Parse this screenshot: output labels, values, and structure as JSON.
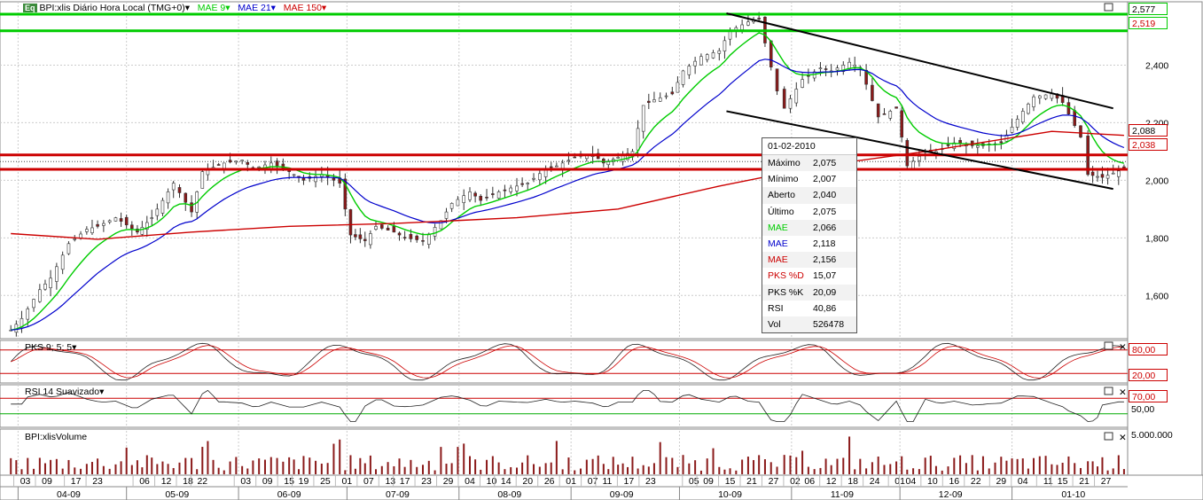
{
  "header": {
    "logo": "Eq",
    "symbol": "BPI:xlis Diário Hora Local (TMG+0)",
    "ma1": "MAE 9",
    "ma2": "MAE 21",
    "ma3": "MAE 150",
    "colors": {
      "ma1": "#00cc00",
      "ma2": "#0000cc",
      "ma3": "#cc0000"
    }
  },
  "chart_data": [
    {
      "type": "candlestick",
      "title": "BPI:xlis Diário Hora Local (TMG+0)",
      "ylim": [
        1.45,
        2.62
      ],
      "y_ticks": [
        "2,400",
        "2,200",
        "2,000",
        "1,800",
        "1,600"
      ],
      "price_labels": [
        {
          "value": 2.577,
          "text": "2,577",
          "color": "#00cc00"
        },
        {
          "value": 2.519,
          "text": "2,519",
          "color": "#00cc00"
        },
        {
          "value": 2.088,
          "text": "2,088",
          "color": "#cc0000"
        },
        {
          "value": 2.038,
          "text": "2,038",
          "color": "#cc0000"
        }
      ],
      "green_lines": [
        2.577,
        2.519
      ],
      "red_lines": [
        2.088,
        2.038
      ],
      "channel": [
        {
          "x1": "2009-10-14",
          "y1": 2.58,
          "x2": "2010-01-29",
          "y2": 2.25
        },
        {
          "x1": "2009-10-14",
          "y1": 2.24,
          "x2": "2010-01-29",
          "y2": 1.97
        }
      ],
      "close_points": [
        [
          "2009-03-30",
          1.48
        ],
        [
          "2009-04-02",
          1.52
        ],
        [
          "2009-04-07",
          1.62
        ],
        [
          "2009-04-10",
          1.66
        ],
        [
          "2009-04-15",
          1.78
        ],
        [
          "2009-04-20",
          1.83
        ],
        [
          "2009-04-23",
          1.84
        ],
        [
          "2009-04-28",
          1.87
        ],
        [
          "2009-05-04",
          1.82
        ],
        [
          "2009-05-08",
          1.87
        ],
        [
          "2009-05-11",
          1.93
        ],
        [
          "2009-05-14",
          1.99
        ],
        [
          "2009-05-19",
          1.89
        ],
        [
          "2009-05-22",
          2.03
        ],
        [
          "2009-05-28",
          2.06
        ],
        [
          "2009-06-02",
          2.07
        ],
        [
          "2009-06-05",
          2.04
        ],
        [
          "2009-06-10",
          2.06
        ],
        [
          "2009-06-15",
          2.03
        ],
        [
          "2009-06-19",
          2.0
        ],
        [
          "2009-06-24",
          2.02
        ],
        [
          "2009-06-29",
          1.99
        ],
        [
          "2009-07-02",
          1.81
        ],
        [
          "2009-07-06",
          1.79
        ],
        [
          "2009-07-09",
          1.84
        ],
        [
          "2009-07-14",
          1.82
        ],
        [
          "2009-07-17",
          1.8
        ],
        [
          "2009-07-22",
          1.79
        ],
        [
          "2009-07-27",
          1.86
        ],
        [
          "2009-07-30",
          1.92
        ],
        [
          "2009-08-04",
          1.96
        ],
        [
          "2009-08-07",
          1.93
        ],
        [
          "2009-08-12",
          1.96
        ],
        [
          "2009-08-17",
          1.98
        ],
        [
          "2009-08-20",
          1.99
        ],
        [
          "2009-08-25",
          2.04
        ],
        [
          "2009-08-28",
          2.05
        ],
        [
          "2009-09-02",
          2.08
        ],
        [
          "2009-09-07",
          2.09
        ],
        [
          "2009-09-10",
          2.06
        ],
        [
          "2009-09-14",
          2.08
        ],
        [
          "2009-09-18",
          2.1
        ],
        [
          "2009-09-21",
          2.26
        ],
        [
          "2009-09-24",
          2.28
        ],
        [
          "2009-09-29",
          2.3
        ],
        [
          "2009-10-02",
          2.38
        ],
        [
          "2009-10-07",
          2.43
        ],
        [
          "2009-10-12",
          2.45
        ],
        [
          "2009-10-15",
          2.52
        ],
        [
          "2009-10-20",
          2.55
        ],
        [
          "2009-10-23",
          2.56
        ],
        [
          "2009-10-28",
          2.31
        ],
        [
          "2009-10-30",
          2.25
        ],
        [
          "2009-11-04",
          2.35
        ],
        [
          "2009-11-09",
          2.39
        ],
        [
          "2009-11-12",
          2.38
        ],
        [
          "2009-11-17",
          2.41
        ],
        [
          "2009-11-20",
          2.39
        ],
        [
          "2009-11-25",
          2.22
        ],
        [
          "2009-11-30",
          2.25
        ],
        [
          "2009-12-03",
          2.05
        ],
        [
          "2009-12-08",
          2.1
        ],
        [
          "2009-12-11",
          2.1
        ],
        [
          "2009-12-16",
          2.13
        ],
        [
          "2009-12-21",
          2.12
        ],
        [
          "2009-12-24",
          2.12
        ],
        [
          "2009-12-29",
          2.13
        ],
        [
          "2010-01-04",
          2.24
        ],
        [
          "2010-01-07",
          2.29
        ],
        [
          "2010-01-12",
          2.3
        ],
        [
          "2010-01-15",
          2.27
        ],
        [
          "2010-01-20",
          2.15
        ],
        [
          "2010-01-22",
          2.02
        ],
        [
          "2010-01-26",
          2.01
        ],
        [
          "2010-02-01",
          2.04
        ]
      ],
      "ma150_points": [
        [
          "2009-03-30",
          1.815
        ],
        [
          "2009-04-23",
          1.795
        ],
        [
          "2009-05-19",
          1.82
        ],
        [
          "2009-06-15",
          1.84
        ],
        [
          "2009-07-14",
          1.85
        ],
        [
          "2009-08-17",
          1.87
        ],
        [
          "2009-09-14",
          1.9
        ],
        [
          "2009-10-12",
          1.98
        ],
        [
          "2009-11-09",
          2.05
        ],
        [
          "2009-12-08",
          2.1
        ],
        [
          "2010-01-12",
          2.17
        ],
        [
          "2010-02-01",
          2.156
        ]
      ]
    },
    {
      "type": "line",
      "title": "PKS 9; 5; 5",
      "ylim": [
        0,
        100
      ],
      "levels": [
        80,
        20
      ],
      "y_ticks": [
        "80,00",
        "20,00"
      ]
    },
    {
      "type": "line",
      "title": "RSI 14 Suavizado",
      "ylim": [
        0,
        100
      ],
      "levels": [
        70,
        30
      ],
      "y_ticks": [
        "70,00",
        "50,00"
      ]
    },
    {
      "type": "bar",
      "title": "BPI:xlisVolume",
      "y_ticks": [
        "5.000.000"
      ]
    }
  ],
  "x_axis": {
    "days": [
      "03",
      "09",
      "17",
      "23",
      "06",
      "12",
      "18",
      "22",
      "03",
      "09",
      "15",
      "19",
      "25",
      "01",
      "07",
      "13",
      "17",
      "23",
      "29",
      "04",
      "10",
      "14",
      "20",
      "26",
      "01",
      "07",
      "11",
      "17",
      "23",
      "05",
      "09",
      "15",
      "21",
      "27",
      "02",
      "06",
      "12",
      "18",
      "24",
      "01",
      "04",
      "10",
      "16",
      "22",
      "29",
      "04",
      "11",
      "15",
      "21",
      "27"
    ],
    "months": [
      "04-09",
      "05-09",
      "06-09",
      "07-09",
      "08-09",
      "09-09",
      "10-09",
      "11-09",
      "12-09",
      "01-10"
    ]
  },
  "info_box": {
    "date": "01-02-2010",
    "rows": [
      {
        "label": "Máximo",
        "value": "2,075",
        "color": "#000000"
      },
      {
        "label": "Mínimo",
        "value": "2,007",
        "color": "#000000"
      },
      {
        "label": "Aberto",
        "value": "2,040",
        "color": "#000000"
      },
      {
        "label": "Último",
        "value": "2,075",
        "color": "#000000"
      },
      {
        "label": "MAE",
        "value": "2,066",
        "color": "#00cc00"
      },
      {
        "label": "MAE",
        "value": "2,118",
        "color": "#0000cc"
      },
      {
        "label": "MAE",
        "value": "2,156",
        "color": "#cc0000"
      },
      {
        "label": "PKS %D",
        "value": "15,07",
        "color": "#cc0000"
      },
      {
        "label": "PKS %K",
        "value": "20,09",
        "color": "#000000"
      },
      {
        "label": "RSI",
        "value": "40,86",
        "color": "#000000"
      },
      {
        "label": "Vol",
        "value": "526478",
        "color": "#000000"
      }
    ]
  }
}
